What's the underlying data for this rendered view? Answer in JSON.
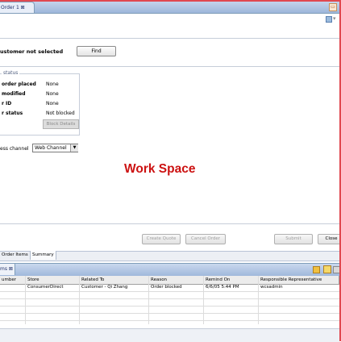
{
  "editor_tab": {
    "label": "Order 1 ⊠"
  },
  "customer": {
    "label": "ustomer not selected",
    "find_label": "Find"
  },
  "order_status": {
    "legend": "status",
    "rows": [
      {
        "label": "order placed",
        "value": "None"
      },
      {
        "label": "modified",
        "value": "None"
      },
      {
        "label": "r ID",
        "value": "None"
      },
      {
        "label": "r status",
        "value": "Not blocked"
      }
    ],
    "block_label": "Block Details"
  },
  "channel": {
    "label": "ess channel",
    "selected": "Web Channel"
  },
  "workspace_text": "Work Space",
  "actions": {
    "create_quote": "Create Quote",
    "cancel_order": "Cancel Order",
    "submit": "Submit",
    "close": "Close"
  },
  "subtabs": [
    "Order Items",
    "Summary"
  ],
  "view_tab": "ms ⊠",
  "grid": {
    "columns": [
      "umber",
      "Store",
      "Related To",
      "Reason",
      "Remind On",
      "Responsible Representative"
    ],
    "rows": [
      [
        "",
        "ConsumerDirect",
        "Customer - Qi Zhang",
        "Order blocked",
        "6/6/05 5:44 PM",
        "wcsadmin"
      ]
    ]
  },
  "colors": {
    "annotation": "#cc1111",
    "frame": "#e04850"
  }
}
